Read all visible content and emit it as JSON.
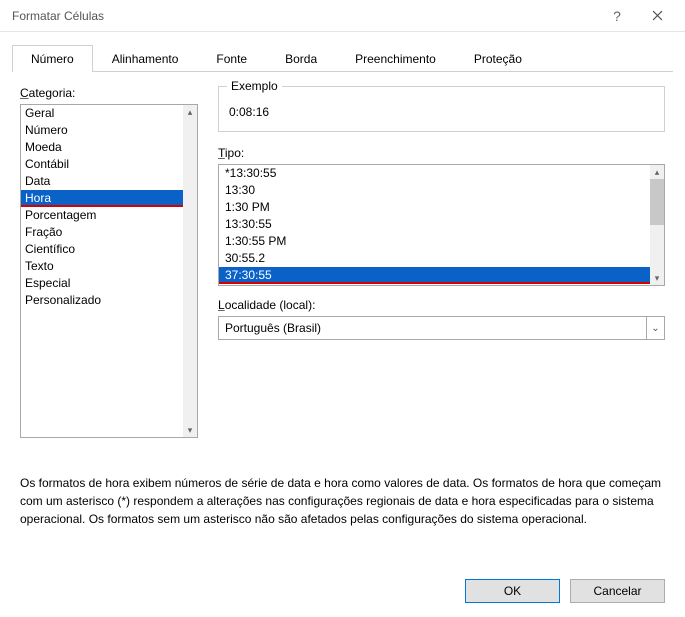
{
  "window": {
    "title": "Formatar Células",
    "help_tip": "?",
    "close_tip": "Fechar"
  },
  "tabs": [
    "Número",
    "Alinhamento",
    "Fonte",
    "Borda",
    "Preenchimento",
    "Proteção"
  ],
  "active_tab_index": 0,
  "category": {
    "label": "Categoria:",
    "items": [
      "Geral",
      "Número",
      "Moeda",
      "Contábil",
      "Data",
      "Hora",
      "Porcentagem",
      "Fração",
      "Científico",
      "Texto",
      "Especial",
      "Personalizado"
    ],
    "selected_index": 5
  },
  "example": {
    "label": "Exemplo",
    "value": "0:08:16"
  },
  "type": {
    "label": "Tipo:",
    "items": [
      "*13:30:55",
      "13:30",
      "1:30 PM",
      "13:30:55",
      "1:30:55 PM",
      "30:55.2",
      "37:30:55"
    ],
    "selected_index": 6
  },
  "locale": {
    "label": "Localidade (local):",
    "value": "Português (Brasil)"
  },
  "description": "Os formatos de hora exibem números de série de data e hora como valores de data. Os formatos de hora que começam com um asterisco (*) respondem a alterações nas configurações regionais de data e hora especificadas para o sistema operacional. Os formatos sem um asterisco não são afetados pelas configurações do sistema operacional.",
  "buttons": {
    "ok": "OK",
    "cancel": "Cancelar"
  }
}
